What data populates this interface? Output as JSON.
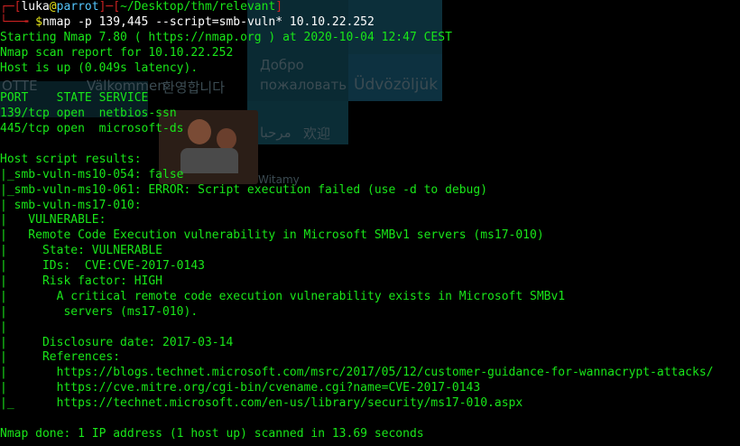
{
  "background": {
    "words": [
      {
        "text": "Добро"
      },
      {
        "text": "пожаловать"
      },
      {
        "text": "Üdvözöljük"
      },
      {
        "text": "환영합니다"
      },
      {
        "text": "Välkommen"
      },
      {
        "text": "ОТТЕ"
      },
      {
        "text": "مرحبا"
      },
      {
        "text": "欢迎"
      },
      {
        "text": "Witamy"
      }
    ]
  },
  "prompt": {
    "open_bracket": "┌─[",
    "user": "luka",
    "at": "@",
    "host": "parrot",
    "sep": "]─[",
    "path": "~/Desktop/thm/relevant",
    "close_bracket": "]",
    "arrow": "└──╼ ",
    "dollar": "$",
    "command": "nmap -p 139,445 --script=smb-vuln* 10.10.22.252"
  },
  "output": [
    "Starting Nmap 7.80 ( https://nmap.org ) at 2020-10-04 12:47 CEST",
    "Nmap scan report for 10.10.22.252",
    "Host is up (0.049s latency).",
    "",
    "PORT    STATE SERVICE",
    "139/tcp open  netbios-ssn",
    "445/tcp open  microsoft-ds",
    "",
    "Host script results:",
    "|_smb-vuln-ms10-054: false",
    "|_smb-vuln-ms10-061: ERROR: Script execution failed (use -d to debug)",
    "| smb-vuln-ms17-010:",
    "|   VULNERABLE:",
    "|   Remote Code Execution vulnerability in Microsoft SMBv1 servers (ms17-010)",
    "|     State: VULNERABLE",
    "|     IDs:  CVE:CVE-2017-0143",
    "|     Risk factor: HIGH",
    "|       A critical remote code execution vulnerability exists in Microsoft SMBv1",
    "|        servers (ms17-010).",
    "|",
    "|     Disclosure date: 2017-03-14",
    "|     References:",
    "|       https://blogs.technet.microsoft.com/msrc/2017/05/12/customer-guidance-for-wannacrypt-attacks/",
    "|       https://cve.mitre.org/cgi-bin/cvename.cgi?name=CVE-2017-0143",
    "|_      https://technet.microsoft.com/en-us/library/security/ms17-010.aspx",
    "",
    "Nmap done: 1 IP address (1 host up) scanned in 13.69 seconds"
  ],
  "colors": {
    "background": "#000000",
    "text": "#19e619",
    "prompt_bracket": "#cc2222",
    "prompt_user": "#e6e619",
    "prompt_host": "#55c8ff"
  }
}
